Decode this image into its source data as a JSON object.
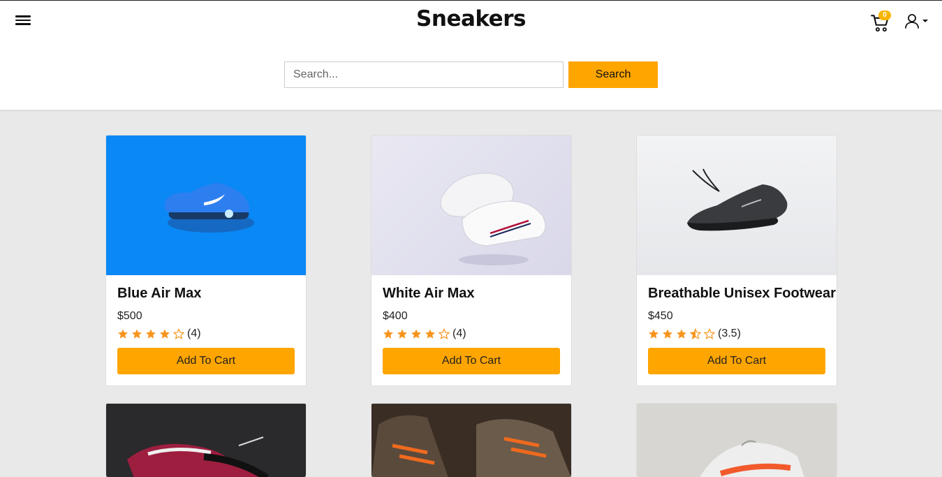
{
  "header": {
    "title": "Sneakers",
    "cart_count": "0"
  },
  "search": {
    "placeholder": "Search...",
    "button_label": "Search"
  },
  "products": [
    {
      "name": "Blue Air Max",
      "price": "$500",
      "rating": 4,
      "rating_label": "(4)",
      "button_label": "Add To Cart"
    },
    {
      "name": "White Air Max",
      "price": "$400",
      "rating": 4,
      "rating_label": "(4)",
      "button_label": "Add To Cart"
    },
    {
      "name": "Breathable Unisex Footwear",
      "price": "$450",
      "rating": 3.5,
      "rating_label": "(3.5)",
      "button_label": "Add To Cart"
    }
  ],
  "colors": {
    "accent": "#ffa500",
    "star": "#f7941d",
    "badge": "#f7b500"
  }
}
